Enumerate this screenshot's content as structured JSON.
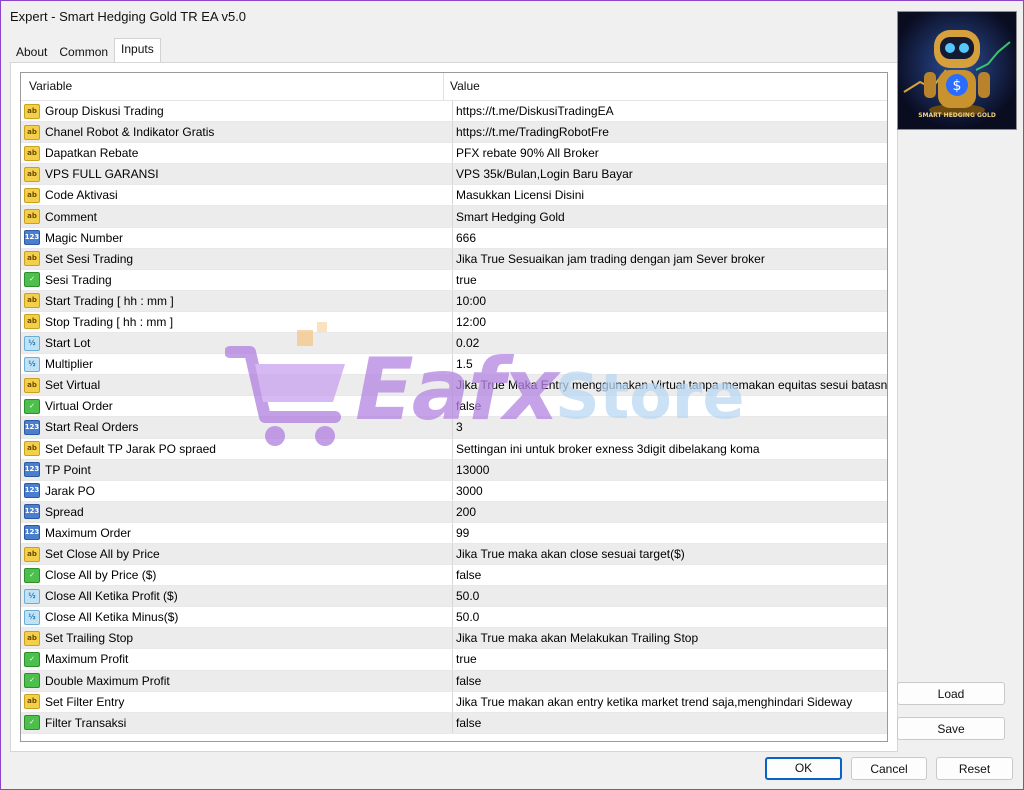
{
  "window": {
    "title": "Expert - Smart Hedging Gold TR EA v5.0"
  },
  "tabs": [
    {
      "label": "About"
    },
    {
      "label": "Common"
    },
    {
      "label": "Inputs"
    }
  ],
  "active_tab": "Inputs",
  "grid": {
    "headers": {
      "variable": "Variable",
      "value": "Value"
    },
    "rows": [
      {
        "type": "string",
        "icon": "ab",
        "variable": "Group Diskusi Trading",
        "value": "https://t.me/DiskusiTradingEA"
      },
      {
        "type": "string",
        "icon": "ab",
        "variable": "Chanel Robot & Indikator Gratis",
        "value": "https://t.me/TradingRobotFre"
      },
      {
        "type": "string",
        "icon": "ab",
        "variable": "Dapatkan Rebate",
        "value": "PFX rebate 90% All Broker"
      },
      {
        "type": "string",
        "icon": "ab",
        "variable": "VPS FULL GARANSI",
        "value": "VPS 35k/Bulan,Login Baru Bayar"
      },
      {
        "type": "string",
        "icon": "ab",
        "variable": "Code Aktivasi",
        "value": "Masukkan Licensi Disini"
      },
      {
        "type": "string",
        "icon": "ab",
        "variable": "Comment",
        "value": "Smart Hedging Gold"
      },
      {
        "type": "int",
        "icon": "123",
        "variable": "Magic Number",
        "value": "666"
      },
      {
        "type": "string",
        "icon": "ab",
        "variable": "Set Sesi Trading",
        "value": "Jika True Sesuaikan jam trading dengan jam Sever broker"
      },
      {
        "type": "bool",
        "icon": "✓",
        "variable": "Sesi Trading",
        "value": "true"
      },
      {
        "type": "string",
        "icon": "ab",
        "variable": "Start Trading [ hh : mm ]",
        "value": "10:00"
      },
      {
        "type": "string",
        "icon": "ab",
        "variable": "Stop Trading [ hh : mm ]",
        "value": "12:00"
      },
      {
        "type": "double",
        "icon": "½",
        "variable": "Start Lot",
        "value": "0.02"
      },
      {
        "type": "double",
        "icon": "½",
        "variable": "Multiplier",
        "value": "1.5"
      },
      {
        "type": "string",
        "icon": "ab",
        "variable": "Set Virtual",
        "value": "Jika True Maka Entry menggunakan Virtual tanpa memakan equitas sesui batasnya"
      },
      {
        "type": "bool",
        "icon": "✓",
        "variable": "Virtual Order",
        "value": "false"
      },
      {
        "type": "int",
        "icon": "123",
        "variable": "Start Real Orders",
        "value": "3"
      },
      {
        "type": "string",
        "icon": "ab",
        "variable": "Set Default TP Jarak PO spraed",
        "value": "Settingan ini untuk broker exness 3digit dibelakang koma"
      },
      {
        "type": "int",
        "icon": "123",
        "variable": "TP Point",
        "value": "13000"
      },
      {
        "type": "int",
        "icon": "123",
        "variable": "Jarak PO",
        "value": "3000"
      },
      {
        "type": "int",
        "icon": "123",
        "variable": "Spread",
        "value": "200"
      },
      {
        "type": "int",
        "icon": "123",
        "variable": "Maximum Order",
        "value": "99"
      },
      {
        "type": "string",
        "icon": "ab",
        "variable": "Set Close All by Price",
        "value": "Jika True maka akan close sesuai target($)"
      },
      {
        "type": "bool",
        "icon": "✓",
        "variable": "Close All by Price ($)",
        "value": "false"
      },
      {
        "type": "double",
        "icon": "½",
        "variable": "Close All Ketika Profit ($)",
        "value": "50.0"
      },
      {
        "type": "double",
        "icon": "½",
        "variable": "Close All Ketika Minus($)",
        "value": "50.0"
      },
      {
        "type": "string",
        "icon": "ab",
        "variable": "Set Trailing Stop",
        "value": "Jika True maka akan Melakukan Trailing Stop"
      },
      {
        "type": "bool",
        "icon": "✓",
        "variable": "Maximum Profit",
        "value": "true"
      },
      {
        "type": "bool",
        "icon": "✓",
        "variable": "Double Maximum Profit",
        "value": "false"
      },
      {
        "type": "string",
        "icon": "ab",
        "variable": "Set Filter Entry",
        "value": "Jika True makan akan entry ketika market trend saja,menghindari Sideway"
      },
      {
        "type": "bool",
        "icon": "✓",
        "variable": "Filter Transaksi",
        "value": "false"
      }
    ]
  },
  "thumbnail": {
    "caption": "SMART HEDGING GOLD"
  },
  "watermark": {
    "part1": "Eafx",
    "part2": "Store"
  },
  "buttons": {
    "load": "Load",
    "save": "Save",
    "ok": "OK",
    "cancel": "Cancel",
    "reset": "Reset"
  }
}
